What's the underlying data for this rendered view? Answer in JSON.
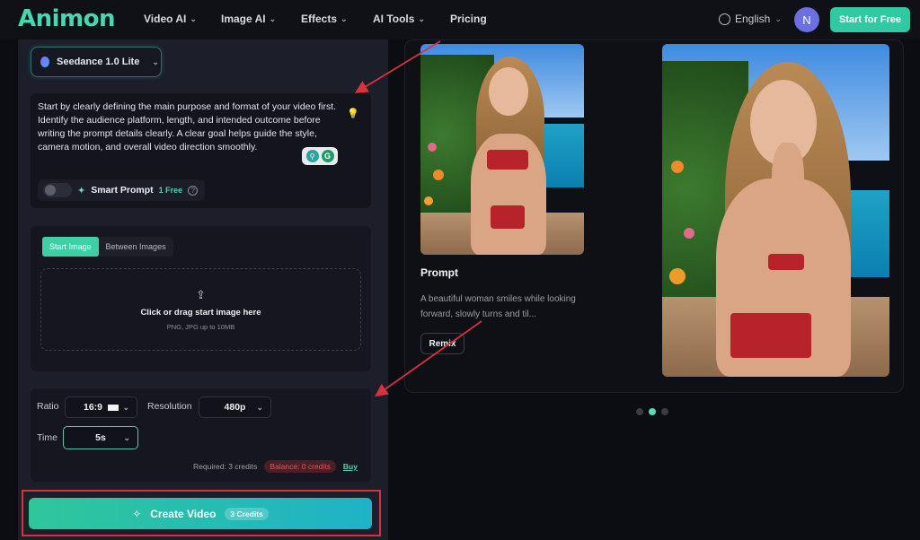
{
  "brand": {
    "logo": "Animon",
    "accent": "#3fcfa5"
  },
  "nav": {
    "items": [
      "Video AI",
      "Image AI",
      "Effects",
      "AI Tools",
      "Pricing"
    ],
    "language": "English",
    "avatar_initial": "N",
    "cta": "Start for Free"
  },
  "generator": {
    "model": "Seedance 1.0 Lite",
    "prompt_text": "Start by clearly defining the main purpose and format of your video first. Identify the audience platform, length, and intended outcome before writing the prompt details clearly. A clear goal helps guide the style, camera motion, and overall video direction smoothly.",
    "ext_b": "G",
    "smart_prompt": {
      "label": "Smart Prompt",
      "badge": "1 Free",
      "enabled": false
    },
    "tabs": [
      "Start Image",
      "Between Images"
    ],
    "active_tab": 0,
    "upload": {
      "title": "Click or drag start image here",
      "subtitle": "PNG, JPG up to 10MB"
    },
    "settings": {
      "ratio_label": "Ratio",
      "ratio_value": "16:9",
      "resolution_label": "Resolution",
      "resolution_value": "480p",
      "time_label": "Time",
      "time_value": "5s"
    },
    "credits": {
      "required": "Required: 3 credits",
      "balance": "Balance: 0 credits",
      "buy": "Buy"
    },
    "create": {
      "label": "Create Video",
      "badge": "3 Credits"
    }
  },
  "showcase": {
    "prompt_heading": "Prompt",
    "prompt_desc": "A beautiful woman smiles while looking forward, slowly turns and til...",
    "remix": "Remix",
    "carousel": {
      "count": 3,
      "active": 2
    }
  }
}
